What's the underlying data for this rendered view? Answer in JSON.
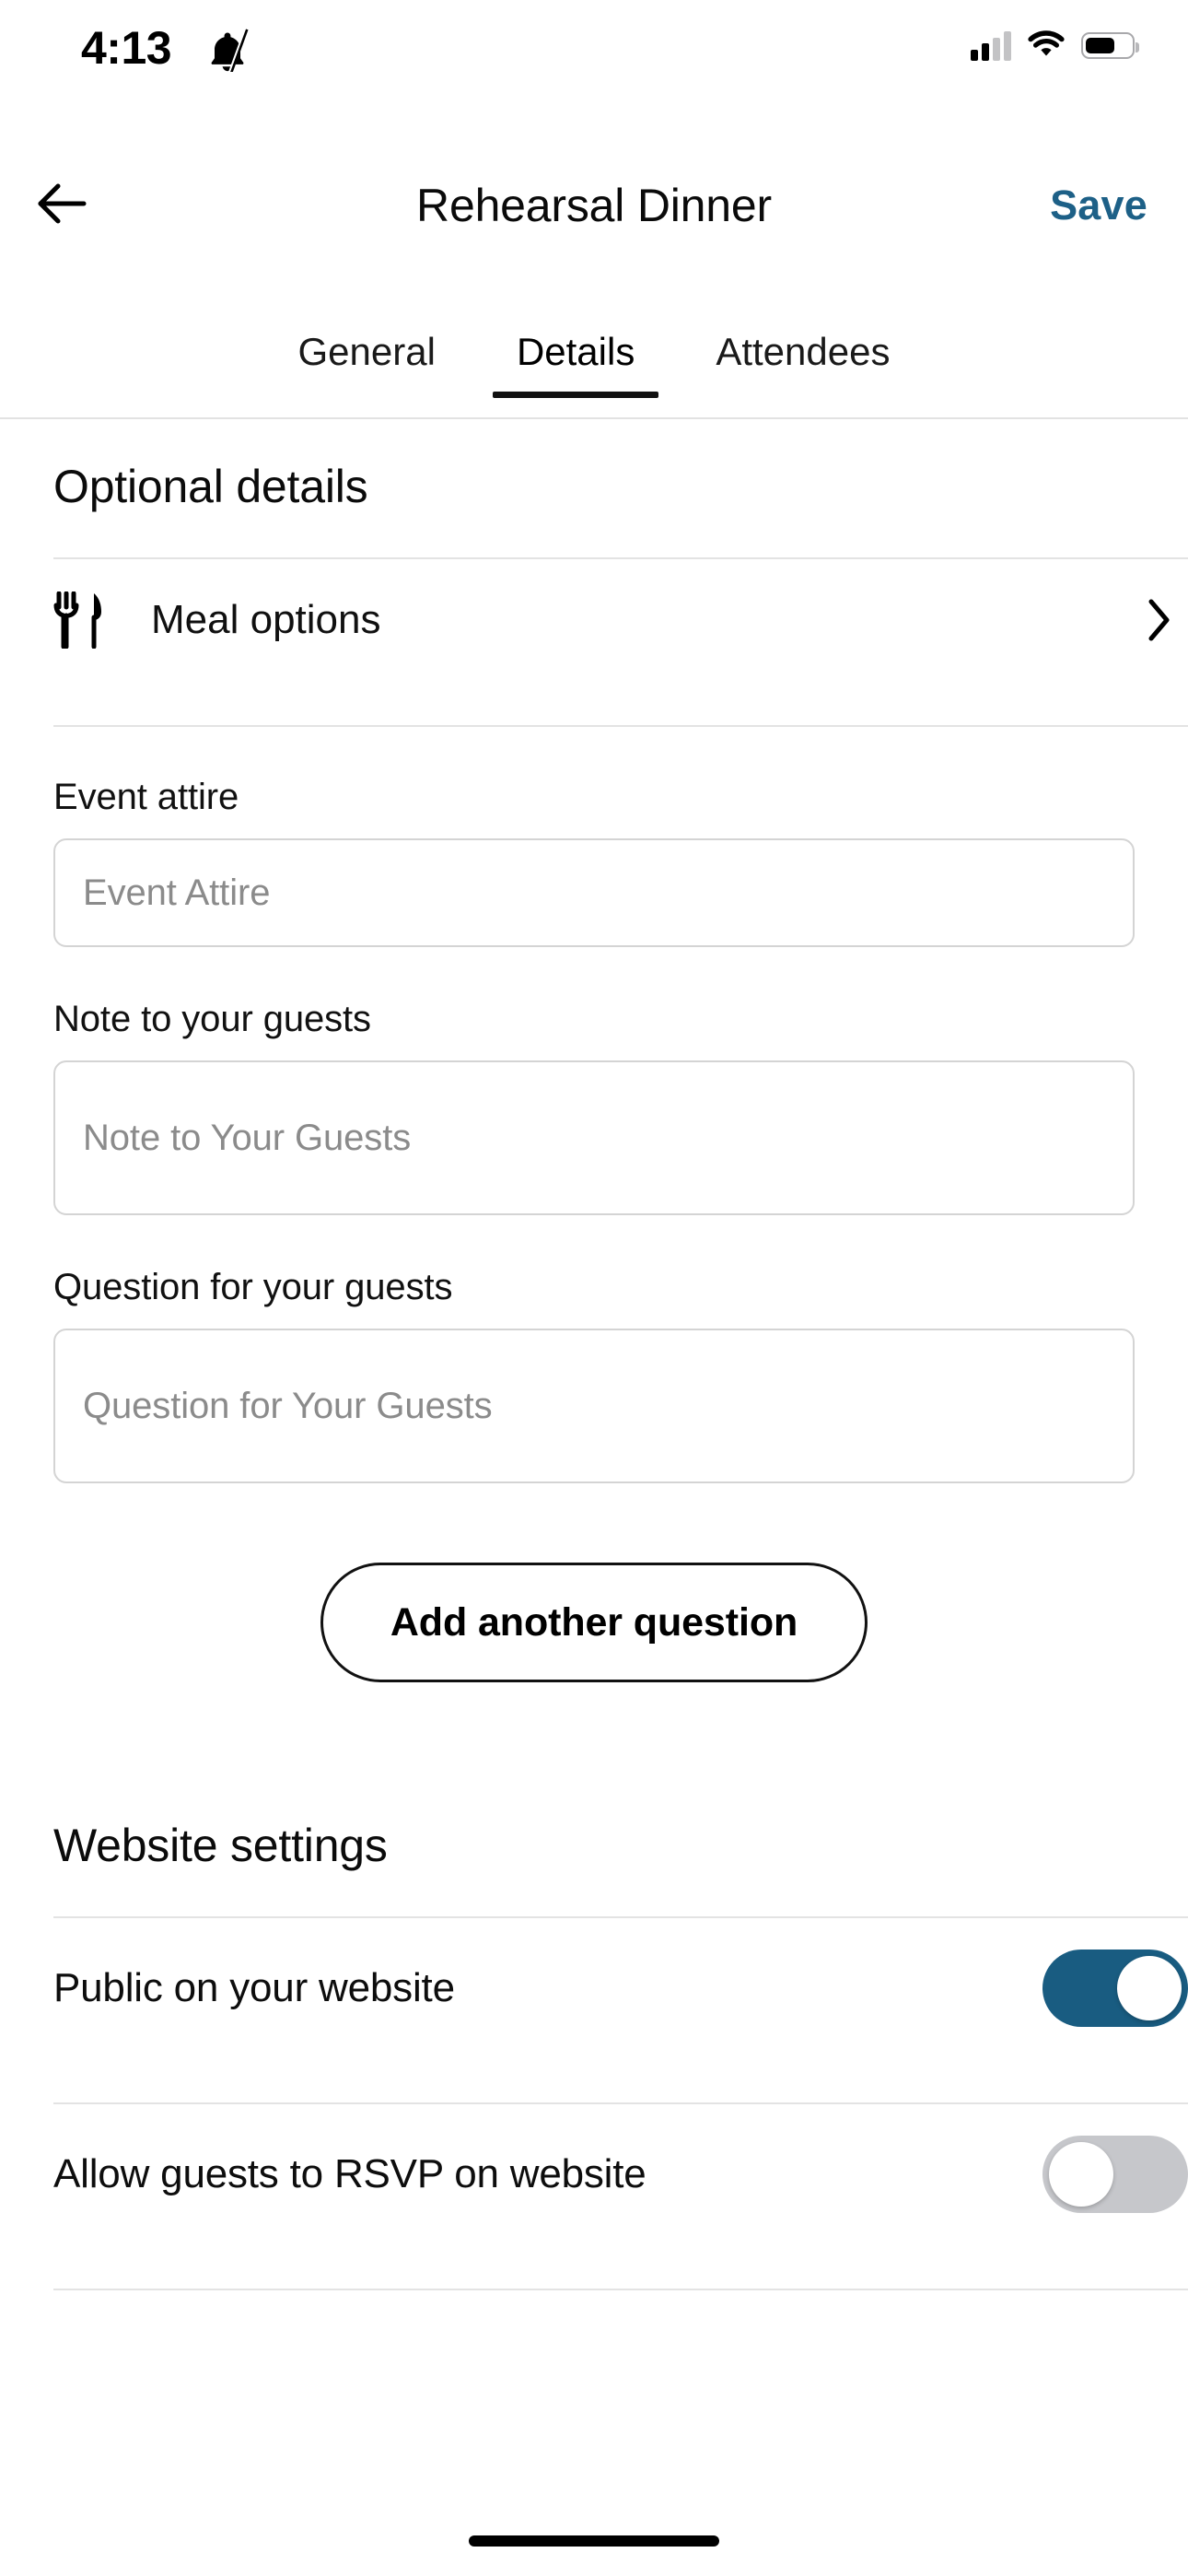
{
  "status_bar": {
    "time": "4:13",
    "bell_icon": "bell-slash-icon",
    "signal_icon": "cellular-signal-icon",
    "wifi_icon": "wifi-icon",
    "battery_icon": "battery-icon"
  },
  "nav": {
    "back_icon": "arrow-left-icon",
    "title": "Rehearsal Dinner",
    "save_label": "Save",
    "save_color": "#1D6087"
  },
  "tabs": [
    {
      "label": "General",
      "active": false
    },
    {
      "label": "Details",
      "active": true
    },
    {
      "label": "Attendees",
      "active": false
    }
  ],
  "sections": {
    "optional_details": {
      "title": "Optional details",
      "meal_row": {
        "icon": "fork-knife-icon",
        "label": "Meal options",
        "chevron": "chevron-right-icon"
      },
      "fields": [
        {
          "label": "Event attire",
          "value": "",
          "placeholder": "Event Attire",
          "size": "one"
        },
        {
          "label": "Note to your guests",
          "value": "",
          "placeholder": "Note to Your Guests",
          "size": "two"
        },
        {
          "label": "Question for your guests",
          "value": "",
          "placeholder": "Question for Your Guests",
          "size": "two"
        }
      ],
      "add_question_label": "Add another question"
    },
    "website_settings": {
      "title": "Website settings",
      "toggles": [
        {
          "label": "Public on your website",
          "on": true
        },
        {
          "label": "Allow guests to RSVP on website",
          "on": false
        }
      ]
    }
  },
  "colors": {
    "accent": "#1D6087",
    "toggle_on": "#195C81",
    "toggle_off": "#C6C7CB",
    "divider": "#E3E3E3",
    "field_border": "#D4D4D4",
    "placeholder": "#8B8B8B"
  },
  "home_indicator": "home-indicator"
}
